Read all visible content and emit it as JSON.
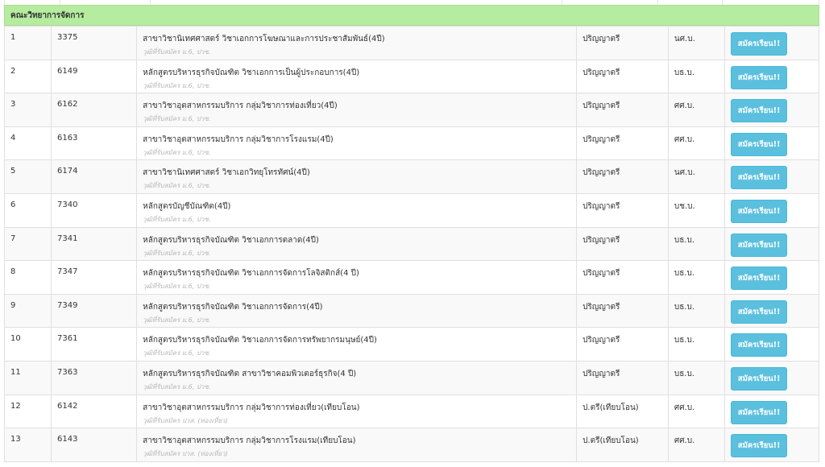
{
  "section_title": "คณะวิทยาการจัดการ",
  "apply_label": "สมัครเรียน!!",
  "rows": [
    {
      "no": "1",
      "code": "3375",
      "name": "สาขาวิชานิเทศศาสตร์ วิชาเอกการโฆษณาและการประชาสัมพันธ์(4ปี)",
      "note": "วุฒิที่รับสมัคร ม.6, ปวช.",
      "degree": "ปริญญาตรี",
      "abbr": "นศ.บ."
    },
    {
      "no": "2",
      "code": "6149",
      "name": "หลักสูตรบริหารธุรกิจบัณฑิต วิชาเอกการเป็นผู้ประกอบการ(4ปี)",
      "note": "วุฒิที่รับสมัคร ม.6, ปวช.",
      "degree": "ปริญญาตรี",
      "abbr": "บธ.บ."
    },
    {
      "no": "3",
      "code": "6162",
      "name": "สาขาวิชาอุตสาหกรรมบริการ กลุ่มวิชาการท่องเที่ยว(4ปี)",
      "note": "วุฒิที่รับสมัคร ม.6, ปวช.",
      "degree": "ปริญญาตรี",
      "abbr": "ศศ.บ."
    },
    {
      "no": "4",
      "code": "6163",
      "name": "สาขาวิชาอุตสาหกรรมบริการ กลุ่มวิชาการโรงแรม(4ปี)",
      "note": "วุฒิที่รับสมัคร ม.6, ปวช.",
      "degree": "ปริญญาตรี",
      "abbr": "ศศ.บ."
    },
    {
      "no": "5",
      "code": "6174",
      "name": "สาขาวิชานิเทศศาสตร์ วิชาเอกวิทยุโทรทัศน์(4ปี)",
      "note": "วุฒิที่รับสมัคร ม.6, ปวช.",
      "degree": "ปริญญาตรี",
      "abbr": "นศ.บ."
    },
    {
      "no": "6",
      "code": "7340",
      "name": "หลักสูตรบัญชีบัณฑิต(4ปี)",
      "note": "วุฒิที่รับสมัคร ม.6, ปวช.",
      "degree": "ปริญญาตรี",
      "abbr": "บช.บ."
    },
    {
      "no": "7",
      "code": "7341",
      "name": "หลักสูตรบริหารธุรกิจบัณฑิต วิชาเอกการตลาด(4ปี)",
      "note": "วุฒิที่รับสมัคร ม.6, ปวช.",
      "degree": "ปริญญาตรี",
      "abbr": "บธ.บ."
    },
    {
      "no": "8",
      "code": "7347",
      "name": "หลักสูตรบริหารธุรกิจบัณฑิต วิชาเอกการจัดการโลจิสติกส์(4 ปี)",
      "note": "วุฒิที่รับสมัคร ม.6, ปวช.",
      "degree": "ปริญญาตรี",
      "abbr": "บธ.บ."
    },
    {
      "no": "9",
      "code": "7349",
      "name": "หลักสูตรบริหารธุรกิจบัณฑิต วิชาเอกการจัดการ(4ปี)",
      "note": "วุฒิที่รับสมัคร ม.6, ปวช.",
      "degree": "ปริญญาตรี",
      "abbr": "บธ.บ."
    },
    {
      "no": "10",
      "code": "7361",
      "name": "หลักสูตรบริหารธุรกิจบัณฑิต วิชาเอกการจัดการทรัพยากรมนุษย์(4ปี)",
      "note": "วุฒิที่รับสมัคร ม.6, ปวช.",
      "degree": "ปริญญาตรี",
      "abbr": "บธ.บ."
    },
    {
      "no": "11",
      "code": "7363",
      "name": "หลักสูตรบริหารธุรกิจบัณฑิต สาขาวิชาคอมพิวเตอร์ธุรกิจ(4 ปี)",
      "note": "วุฒิที่รับสมัคร ม.6, ปวช.",
      "degree": "ปริญญาตรี",
      "abbr": "บธ.บ."
    },
    {
      "no": "12",
      "code": "6142",
      "name": "สาขาวิชาอุตสาหกรรมบริการ กลุ่มวิชาการท่องเที่ยว(เทียบโอน)",
      "note": "วุฒิที่รับสมัคร ปวส. (ท่องเที่ยว)",
      "degree": "ป.ตรี(เทียบโอน)",
      "abbr": "ศศ.บ."
    },
    {
      "no": "13",
      "code": "6143",
      "name": "สาขาวิชาอุตสาหกรรมบริการ กลุ่มวิชาการโรงแรม(เทียบโอน)",
      "note": "วุฒิที่รับสมัคร ปวส. (ท่องเที่ยว)",
      "degree": "ป.ตรี(เทียบโอน)",
      "abbr": "ศศ.บ."
    }
  ]
}
